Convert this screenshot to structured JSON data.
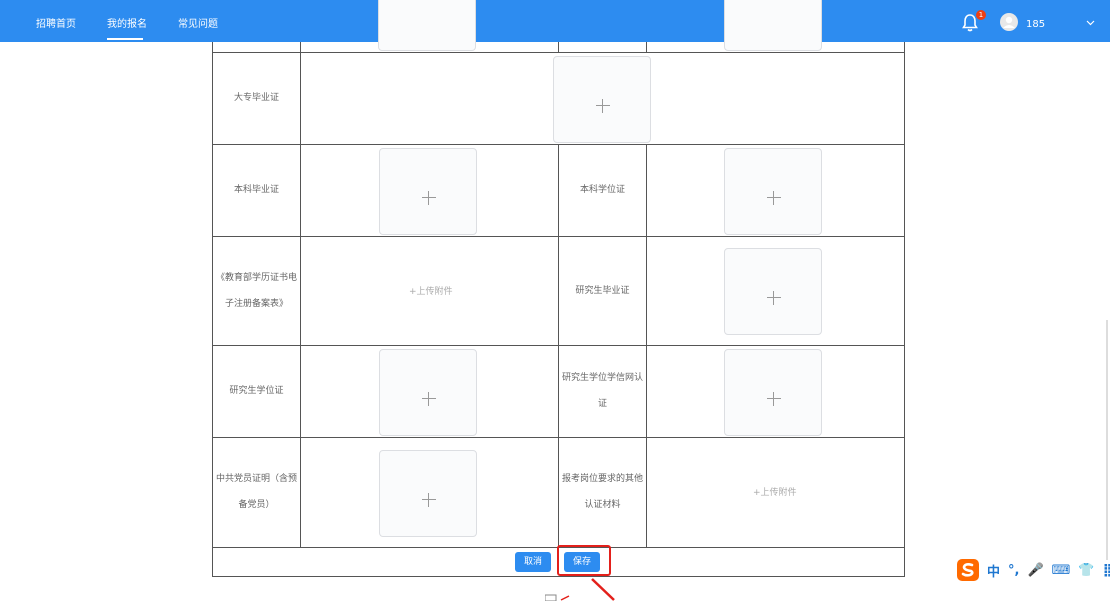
{
  "nav": {
    "items": [
      "招聘首页",
      "我的报名",
      "常见问题"
    ],
    "notification_count": "1",
    "username": "185"
  },
  "table": {
    "rows": [
      {
        "left_label": "大专毕业证"
      },
      {
        "left_label": "本科毕业证",
        "right_label": "本科学位证"
      },
      {
        "left_label": "《教育部学历证书电子注册备案表》",
        "left_action": "+上传附件",
        "right_label": "研究生毕业证"
      },
      {
        "left_label": "研究生学位证",
        "right_label": "研究生学位学信网认证"
      },
      {
        "left_label": "中共党员证明（含预备党员）",
        "right_label": "报考岗位要求的其他认证材料",
        "right_action": "+上传附件"
      }
    ]
  },
  "buttons": {
    "cancel": "取消",
    "save": "保存"
  },
  "ime": {
    "items": [
      "中",
      "°,",
      "🎤",
      "⌨",
      "👕",
      "⣿"
    ]
  },
  "colors": {
    "primary": "#2d8cf0",
    "highlight": "#e3201b",
    "border": "#555555"
  }
}
